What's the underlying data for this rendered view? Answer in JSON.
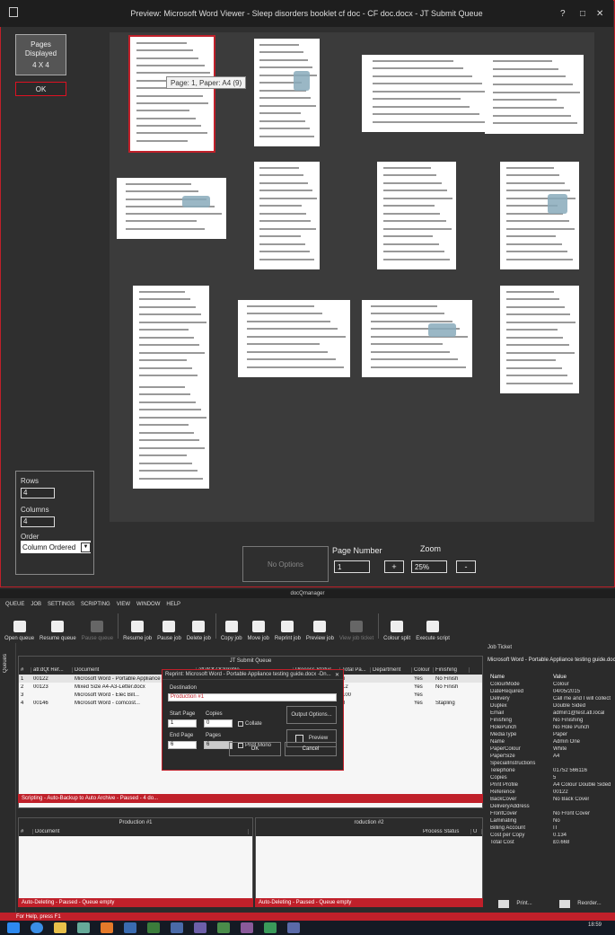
{
  "preview": {
    "title": "Preview:  Microsoft Word Viewer - Sleep disorders booklet cf doc - CF doc.docx  - JT Submit Queue",
    "controls": [
      "?",
      "□",
      "✕"
    ],
    "pages_displayed_label": "Pages Displayed",
    "pages_displayed_value": "4 X 4",
    "ok_label": "OK",
    "tooltip": "Page: 1, Paper: A4 (9)",
    "rows_label": "Rows",
    "rows_value": "4",
    "columns_label": "Columns",
    "columns_value": "4",
    "order_label": "Order",
    "order_value": "Column Ordered",
    "no_options_label": "No Options",
    "page_number_label": "Page Number",
    "page_number_value": "1",
    "zoom_label": "Zoom",
    "zoom_value": "25%",
    "plus": "+",
    "minus": "-"
  },
  "docmanager": {
    "title": "docQmanager",
    "menu": [
      "QUEUE",
      "JOB",
      "SETTINGS",
      "SCRIPTING",
      "VIEW",
      "WINDOW",
      "HELP"
    ],
    "ribbon": [
      {
        "label": "Open queue",
        "enabled": true
      },
      {
        "label": "Resume queue",
        "enabled": true
      },
      {
        "label": "Pause queue",
        "enabled": false
      },
      {
        "label": "Resume job",
        "enabled": true
      },
      {
        "label": "Pause job",
        "enabled": true
      },
      {
        "label": "Delete job",
        "enabled": true
      },
      {
        "label": "Copy job",
        "enabled": true
      },
      {
        "label": "Move job",
        "enabled": true
      },
      {
        "label": "Reprint job",
        "enabled": true
      },
      {
        "label": "Preview job",
        "enabled": true
      },
      {
        "label": "View job ticket",
        "enabled": false
      },
      {
        "label": "Colour split",
        "enabled": true
      },
      {
        "label": "Execute script",
        "enabled": true
      }
    ],
    "side_tab": "Queues",
    "main_queue": {
      "title": "JT Submit Queue",
      "columns": [
        "#",
        "atl:dQt Ref...",
        "Document",
        "atl:dQt OOProfile",
        "Process Status",
        "Total Pa...",
        "Department",
        "Colour",
        "Finishing"
      ],
      "rows": [
        [
          "1",
          "00122",
          "Microsoft Word - Portable Appliance testi...",
          "A4 Colour Double Sided",
          "Finished",
          "6",
          "",
          "Yes",
          "No Finish"
        ],
        [
          "2",
          "00123",
          "Mixed Size A4-A3-Letter.docx",
          "A4 Black and White Double Sided",
          "Finished",
          "12",
          "",
          "Yes",
          "No Finish"
        ],
        [
          "3",
          "",
          "Microsoft Word - Elec Bill...",
          "",
          "",
          "100",
          "",
          "Yes",
          ""
        ],
        [
          "4",
          "00146",
          "Microsoft Word - comcost...",
          "",
          "",
          "8",
          "",
          "Yes",
          "Stapling"
        ]
      ],
      "status": "Scripting - Auto-Backup to Auto Archive - Paused - 4 do..."
    },
    "production1": {
      "title": "Production #1",
      "columns": [
        "#",
        "Document"
      ],
      "status": "Auto-Deleting - Paused - Queue empty"
    },
    "production2": {
      "title": "roduction #2",
      "columns": [
        "Process Status",
        "U"
      ],
      "status": "Auto-Deleting - Paused - Queue empty"
    },
    "job_ticket": {
      "header": "Job Ticket",
      "title": "Microsoft Word - Portable Appliance testing guide.doc",
      "col_name": "Name",
      "col_value": "Value",
      "items": [
        [
          "ColourMode",
          "Colour"
        ],
        [
          "DateRequired",
          "04/05/2015"
        ],
        [
          "Delivery",
          "Call me and I will collect"
        ],
        [
          "Duplex",
          "Double Sided"
        ],
        [
          "Email",
          "admin1@test.atl.local"
        ],
        [
          "Finishing",
          "No Finishing"
        ],
        [
          "HolePunch",
          "No Hole Punch"
        ],
        [
          "MediaType",
          "Paper"
        ],
        [
          "Name",
          "Admin One"
        ],
        [
          "PaperColour",
          "White"
        ],
        [
          "PaperSize",
          "A4"
        ],
        [
          "SpecialInstructions",
          ""
        ],
        [
          "Telephone",
          "01752 566116"
        ],
        [
          "Copies",
          "5"
        ],
        [
          "Print Profile",
          "A4 Colour Double Sided"
        ],
        [
          "Reference",
          "00122"
        ],
        [
          "BackCover",
          "No Back Cover"
        ],
        [
          "DeliveryAddress",
          ""
        ],
        [
          "FrontCover",
          "No Front Cover"
        ],
        [
          "Laminating",
          "No"
        ],
        [
          "Billing Account",
          "IT"
        ],
        [
          "Cost per Copy",
          "0.134"
        ],
        [
          "Total Cost",
          "£0.668"
        ]
      ],
      "print_label": "Print...",
      "reorder_label": "Reorder..."
    },
    "reprint": {
      "title": "Reprint: Microsoft Word - Portable Appliance testing guide.docx -Dn...",
      "close": "✕",
      "destination_label": "Destination",
      "destination_value": "Production #1",
      "start_page_label": "Start Page",
      "start_page_value": "1",
      "copies_label": "Copies",
      "copies_value": "0",
      "collate_label": "Collate",
      "end_page_label": "End Page",
      "end_page_value": "6",
      "pages_label": "Pages",
      "pages_value": "6",
      "print_mono_label": "Print Mono",
      "output_options_label": "Output Options...",
      "preview_label": "Preview",
      "ok_label": "OK",
      "cancel_label": "Cancel"
    },
    "help": "For Help, press F1",
    "clock_time": "18:59"
  }
}
